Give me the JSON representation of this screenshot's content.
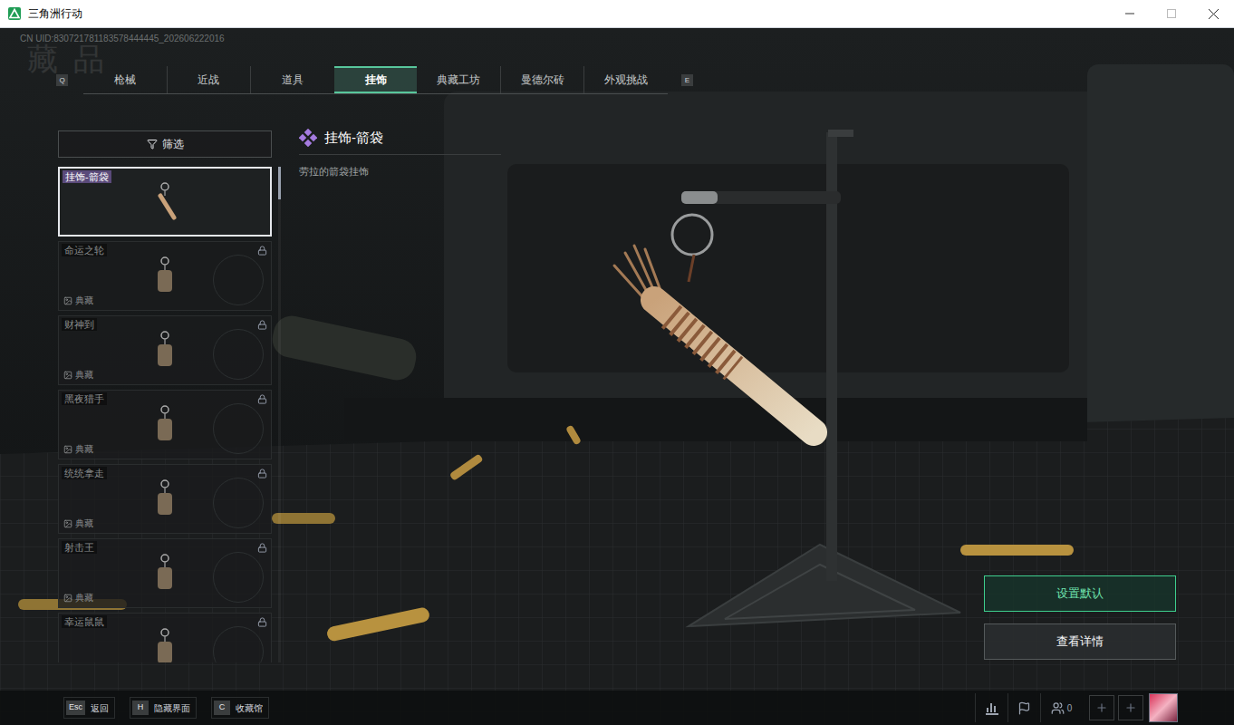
{
  "window": {
    "title": "三角洲行动"
  },
  "uid": "CN UID:830721781183578444445_202606222016",
  "watermark": "藏 品",
  "tab_keys": {
    "prev": "Q",
    "next": "E"
  },
  "tabs": [
    {
      "label": "枪械",
      "selected": false
    },
    {
      "label": "近战",
      "selected": false
    },
    {
      "label": "道具",
      "selected": false
    },
    {
      "label": "挂饰",
      "selected": true
    },
    {
      "label": "典藏工坊",
      "selected": false
    },
    {
      "label": "曼德尔砖",
      "selected": false
    },
    {
      "label": "外观挑战",
      "selected": false
    }
  ],
  "filter": {
    "label": "筛选"
  },
  "items": [
    {
      "name": "挂饰-箭袋",
      "selected": true,
      "locked": false
    },
    {
      "name": "命运之轮",
      "selected": false,
      "locked": true,
      "tag": "典藏"
    },
    {
      "name": "财神到",
      "selected": false,
      "locked": true,
      "tag": "典藏"
    },
    {
      "name": "黑夜猎手",
      "selected": false,
      "locked": true,
      "tag": "典藏"
    },
    {
      "name": "统统拿走",
      "selected": false,
      "locked": true,
      "tag": "典藏"
    },
    {
      "name": "射击王",
      "selected": false,
      "locked": true,
      "tag": "典藏"
    },
    {
      "name": "幸运鼠鼠",
      "selected": false,
      "locked": true
    }
  ],
  "detail": {
    "title": "挂饰-箭袋",
    "description": "劳拉的箭袋挂饰"
  },
  "actions": [
    {
      "label": "设置默认",
      "primary": true
    },
    {
      "label": "查看详情",
      "primary": false
    }
  ],
  "hints": [
    {
      "key": "Esc",
      "label": "返回"
    },
    {
      "key": "H",
      "label": "隐藏界面"
    },
    {
      "key": "C",
      "label": "收藏馆"
    }
  ],
  "friends": {
    "count": "0"
  }
}
